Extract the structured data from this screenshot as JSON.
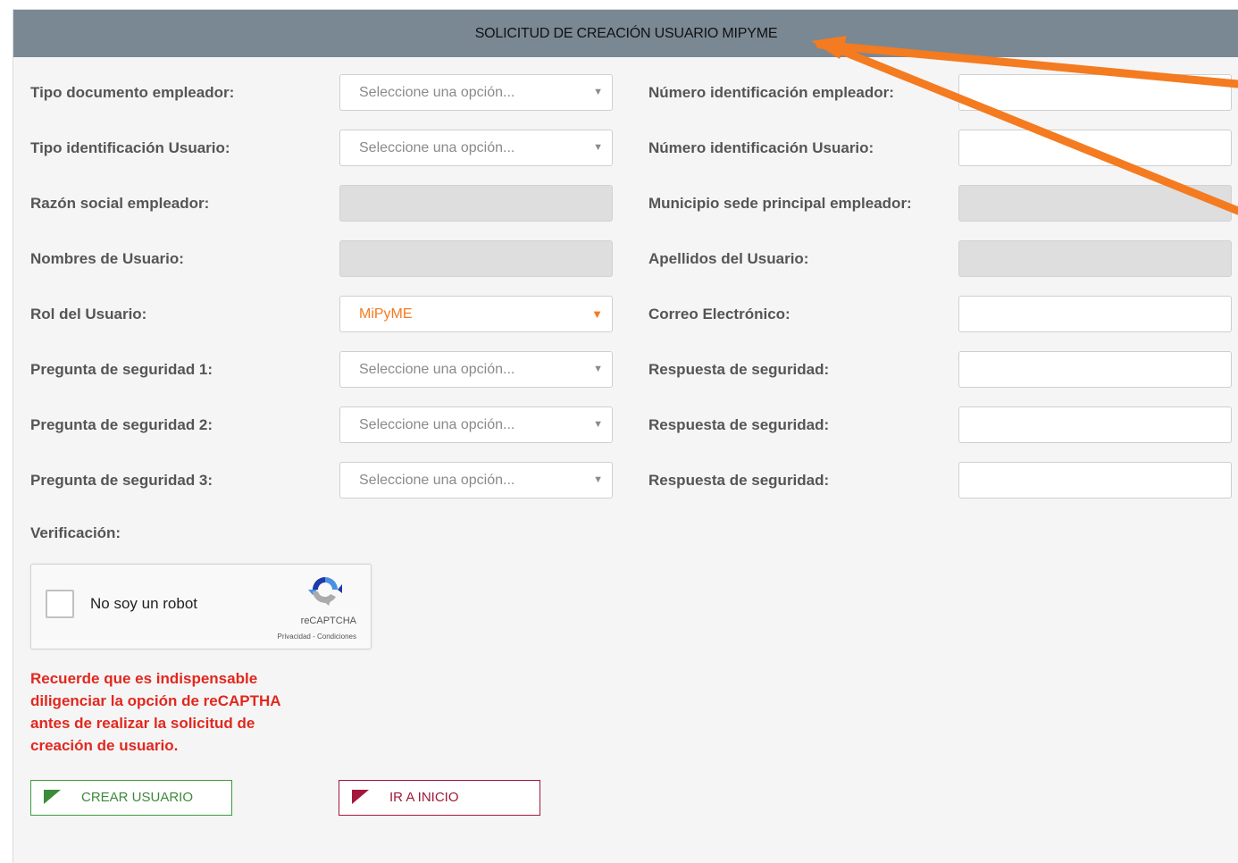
{
  "header": {
    "title": "SOLICITUD DE CREACIÓN USUARIO MIPYME"
  },
  "form": {
    "rows": [
      {
        "left_label": "Tipo documento empleador:",
        "left_placeholder": "Seleccione una opción...",
        "right_label": "Número identificación empleador:"
      },
      {
        "left_label": "Tipo identificación Usuario:",
        "left_placeholder": "Seleccione una opción...",
        "right_label": "Número identificación Usuario:"
      },
      {
        "left_label": "Razón social empleador:",
        "right_label": "Municipio sede principal empleador:"
      },
      {
        "left_label": "Nombres de Usuario:",
        "right_label": "Apellidos del Usuario:"
      },
      {
        "left_label": "Rol del Usuario:",
        "left_value": "MiPyME",
        "right_label": "Correo Electrónico:"
      },
      {
        "left_label": "Pregunta de seguridad 1:",
        "left_placeholder": "Seleccione una opción...",
        "right_label": "Respuesta de seguridad:"
      },
      {
        "left_label": "Pregunta de seguridad 2:",
        "left_placeholder": "Seleccione una opción...",
        "right_label": "Respuesta de seguridad:"
      },
      {
        "left_label": "Pregunta de seguridad 3:",
        "left_placeholder": "Seleccione una opción...",
        "right_label": "Respuesta de seguridad:"
      }
    ]
  },
  "verification": {
    "label": "Verificación:",
    "captcha_label": "No soy un robot",
    "captcha_brand": "reCAPTCHA",
    "captcha_links": "Privacidad - Condiciones"
  },
  "warning": "Recuerde que es indispensable diligenciar la opción de reCAPTHA antes de realizar la solicitud de creación de usuario.",
  "buttons": {
    "create": "CREAR USUARIO",
    "home": "IR A INICIO"
  },
  "icons": {
    "dropdown": "chevron-down-icon",
    "captcha": "recaptcha-logo-icon",
    "button_flag": "flag-icon"
  },
  "colors": {
    "header_bg": "#7a8893",
    "accent": "#f47b20",
    "warning": "#e1281f",
    "create": "#3b8b3b",
    "home": "#a3173b",
    "annotation": "#f47b20"
  }
}
